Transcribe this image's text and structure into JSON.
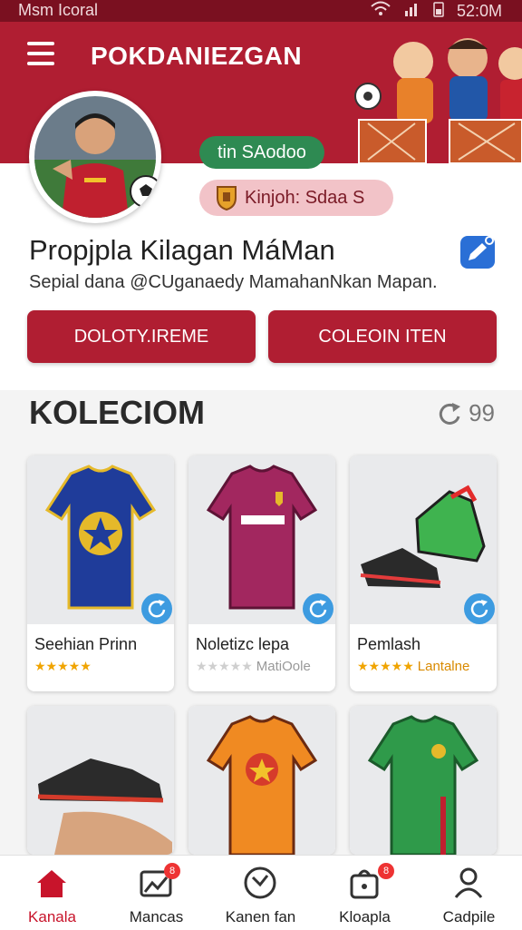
{
  "status_bar": {
    "left": "Msm Icoral",
    "time": "52:0M"
  },
  "header": {
    "title": "POKDANIEZGAN"
  },
  "profile": {
    "status_chip": "tin SAodoo",
    "league_chip": "Kinjoh: Sdaa S",
    "name": "Propjpla Kilagan MáMan",
    "bio": "Sepial dana @CUganaedy MamahanNkan Mapan."
  },
  "actions": {
    "primary": "DOLOTY.IREME",
    "secondary": "COLEOIN ITEN"
  },
  "collection": {
    "title": "KOLECIOM",
    "count": "99",
    "items": [
      {
        "title": "Seehian Prinn",
        "rating": 5,
        "subtitle": ""
      },
      {
        "title": "Noletizc lepa",
        "rating": 0,
        "subtitle": "MatiOole"
      },
      {
        "title": "Pemlash",
        "rating": 5,
        "subtitle": "Lantalne"
      },
      {
        "title": "",
        "rating": 0,
        "subtitle": ""
      },
      {
        "title": "",
        "rating": 0,
        "subtitle": ""
      },
      {
        "title": "",
        "rating": 0,
        "subtitle": ""
      }
    ]
  },
  "nav": [
    {
      "label": "Kanala",
      "icon": "home-icon",
      "active": true
    },
    {
      "label": "Mancas",
      "icon": "chart-icon",
      "badge": "8"
    },
    {
      "label": "Kanen fan",
      "icon": "ball-icon"
    },
    {
      "label": "Kloapla",
      "icon": "bag-icon",
      "badge": "8"
    },
    {
      "label": "Cadpile",
      "icon": "profile-icon"
    }
  ],
  "colors": {
    "brand": "#b01e32",
    "accent_green": "#2e8a52",
    "star": "#f0a400",
    "edit_blue": "#2a6fd6"
  }
}
